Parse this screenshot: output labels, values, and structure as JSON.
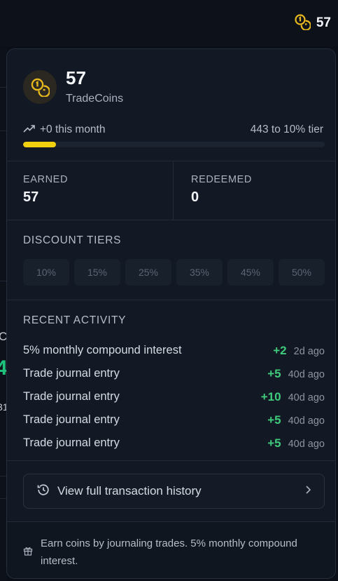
{
  "topbar": {
    "coin_count": "57",
    "coin_icon": "coins-icon"
  },
  "background_fragments": {
    "letter_c": "C",
    "big_green": "4",
    "small_digit": "31"
  },
  "summary": {
    "balance": "57",
    "unit": "TradeCoins",
    "month_change": "+0 this month",
    "next_tier_text": "443 to 10% tier",
    "progress_fraction": 0.11
  },
  "stats": {
    "earned_label": "EARNED",
    "earned_value": "57",
    "redeemed_label": "REDEEMED",
    "redeemed_value": "0"
  },
  "tiers": {
    "title": "DISCOUNT TIERS",
    "items": [
      "10%",
      "15%",
      "25%",
      "35%",
      "45%",
      "50%"
    ]
  },
  "activity": {
    "title": "RECENT ACTIVITY",
    "items": [
      {
        "label": "5% monthly compound interest",
        "amount": "+2",
        "time": "2d ago"
      },
      {
        "label": "Trade journal entry",
        "amount": "+5",
        "time": "40d ago"
      },
      {
        "label": "Trade journal entry",
        "amount": "+10",
        "time": "40d ago"
      },
      {
        "label": "Trade journal entry",
        "amount": "+5",
        "time": "40d ago"
      },
      {
        "label": "Trade journal entry",
        "amount": "+5",
        "time": "40d ago"
      }
    ]
  },
  "history_button": {
    "label": "View full transaction history"
  },
  "footer": {
    "text": "Earn coins by journaling trades. 5% monthly compound interest."
  },
  "colors": {
    "accent": "#f1d10d",
    "positive": "#3fcb7c",
    "panel": "#121824"
  }
}
